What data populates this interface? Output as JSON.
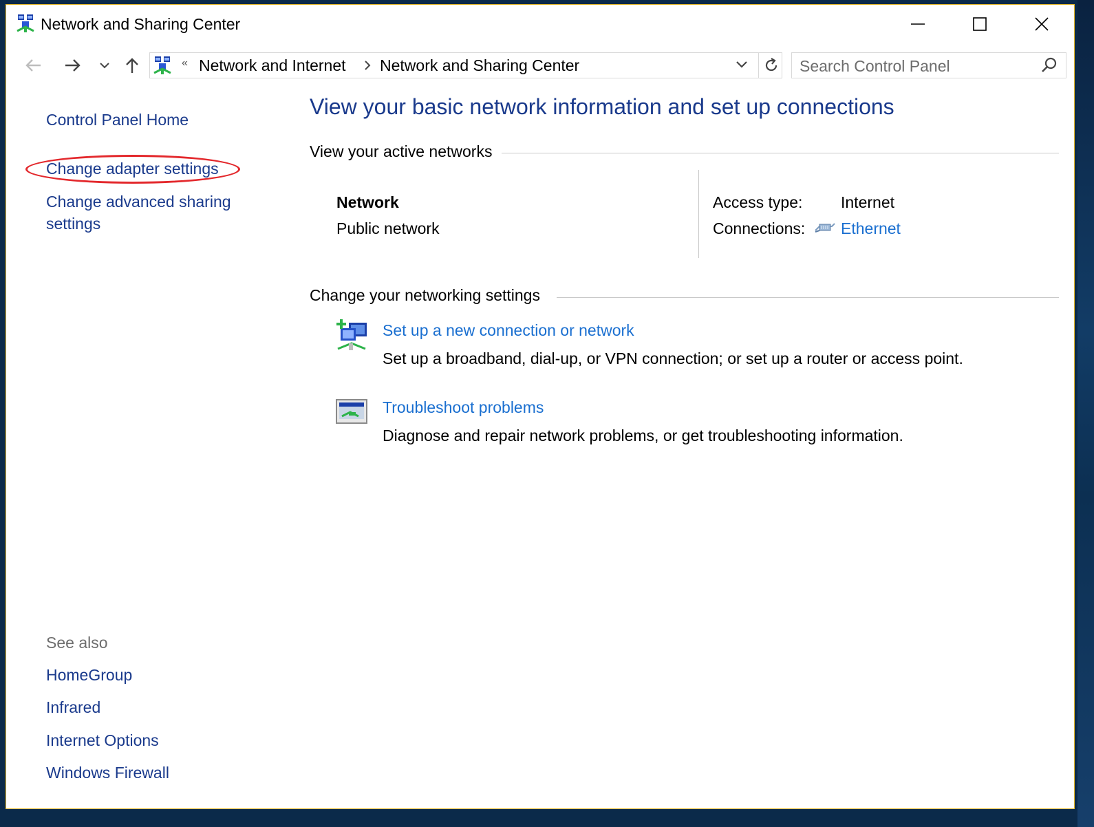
{
  "window": {
    "title": "Network and Sharing Center",
    "icon": "network-sharing-icon",
    "controls": [
      "minimize-icon",
      "maximize-icon",
      "close-icon"
    ]
  },
  "navigation": {
    "back_icon": "back-arrow-icon",
    "forward_icon": "forward-arrow-icon",
    "recent_icon": "chevron-down-icon",
    "up_icon": "up-arrow-icon",
    "breadcrumb": {
      "overflow": "«",
      "items": [
        "Network and Internet",
        "Network and Sharing Center"
      ]
    },
    "search": {
      "placeholder": "Search Control Panel",
      "value": ""
    }
  },
  "left_pane": {
    "links": [
      "Control Panel Home",
      "Change adapter settings",
      "Change advanced sharing settings"
    ],
    "advanced_sharing_lines": [
      "Change advanced sharing",
      "settings"
    ],
    "see_also_heading": "See also",
    "see_also": [
      "HomeGroup",
      "Infrared",
      "Internet Options",
      "Windows Firewall"
    ],
    "highlight_color": "#e3282c"
  },
  "main": {
    "title": "View your basic network information and set up connections",
    "active_networks_heading": "View your active networks",
    "network": {
      "name": "Network",
      "type": "Public network",
      "access_type_label": "Access type:",
      "access_type_value": "Internet",
      "connections_label": "Connections:",
      "connections_icon": "ethernet-icon",
      "connections_value": "Ethernet"
    },
    "networking_settings_heading": "Change your networking settings",
    "tasks": [
      {
        "icon": "new-connection-icon",
        "link": "Set up a new connection or network",
        "description": "Set up a broadband, dial-up, or VPN connection; or set up a router or access point."
      },
      {
        "icon": "troubleshoot-icon",
        "link": "Troubleshoot problems",
        "description": "Diagnose and repair network problems, or get troubleshooting information."
      }
    ]
  },
  "colors": {
    "nav_link": "#1a3a8c",
    "task_link": "#1a6fd0",
    "window_border": "#e3b72a"
  }
}
